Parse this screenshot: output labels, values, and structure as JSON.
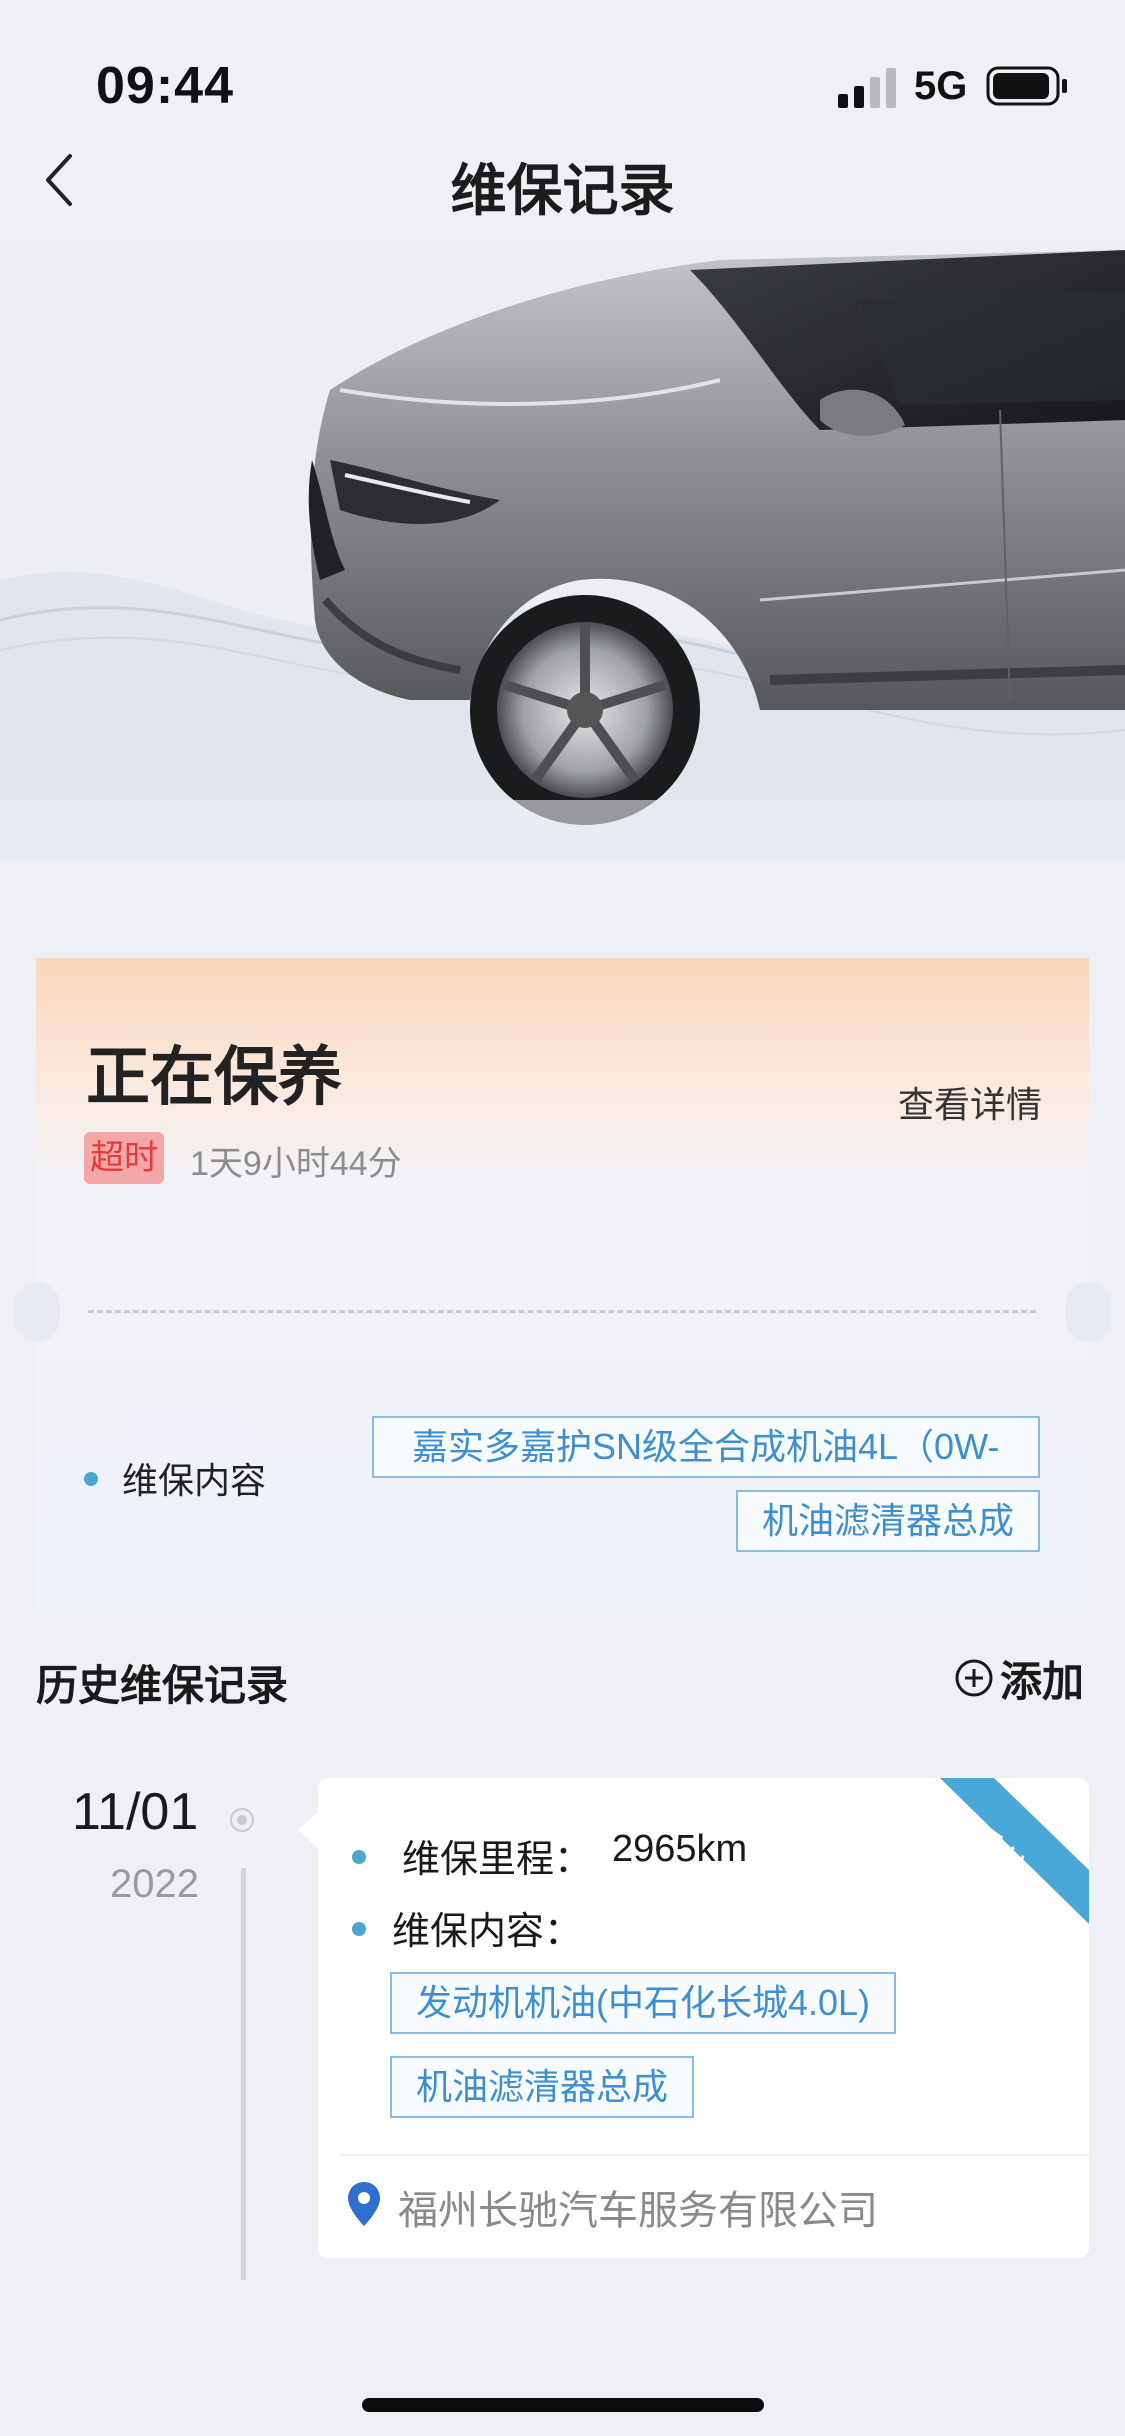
{
  "status_bar": {
    "time": "09:44",
    "network": "5G"
  },
  "nav": {
    "title": "维保记录"
  },
  "current": {
    "title": "正在保养",
    "view_detail": "查看详情",
    "overtime_badge": "超时",
    "elapsed": "1天9小时44分",
    "content_label": "维保内容",
    "items": [
      "嘉实多嘉护SN级全合成机油4L（0W-",
      "机油滤清器总成"
    ]
  },
  "history": {
    "title": "历史维保记录",
    "add_label": "添加",
    "records": [
      {
        "date": "11/01",
        "year": "2022",
        "ribbon": "系统",
        "mileage_label": "维保里程：",
        "mileage": "2965km",
        "content_label": "维保内容：",
        "items": [
          "发动机机油(中石化长城4.0L)",
          "机油滤清器总成"
        ],
        "shop": "福州长驰汽车服务有限公司"
      }
    ]
  },
  "colors": {
    "accent_blue": "#3d8fd1",
    "overtime_red": "#e63b3b",
    "ribbon_blue": "#4aa8d8"
  }
}
